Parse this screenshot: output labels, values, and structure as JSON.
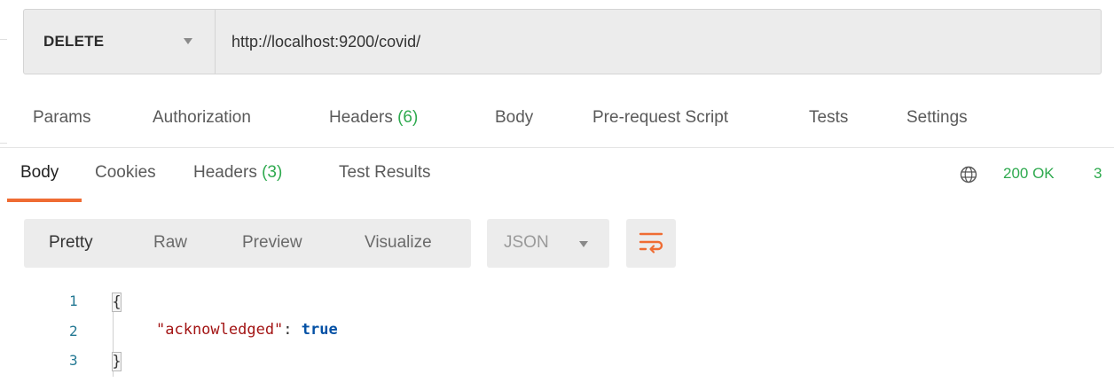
{
  "request": {
    "method": "DELETE",
    "url": "http://localhost:9200/covid/"
  },
  "request_tabs": {
    "params": "Params",
    "authorization": "Authorization",
    "headers": "Headers",
    "headers_count": "(6)",
    "body": "Body",
    "prerequest": "Pre-request Script",
    "tests": "Tests",
    "settings": "Settings"
  },
  "response_tabs": {
    "body": "Body",
    "cookies": "Cookies",
    "headers": "Headers",
    "headers_count": "(3)",
    "test_results": "Test Results"
  },
  "status": {
    "text": "200 OK",
    "time_fragment": "3"
  },
  "view_modes": {
    "pretty": "Pretty",
    "raw": "Raw",
    "preview": "Preview",
    "visualize": "Visualize"
  },
  "format": {
    "selected": "JSON"
  },
  "code": {
    "line_numbers": [
      "1",
      "2",
      "3"
    ],
    "open_brace": "{",
    "close_brace": "}",
    "key": "\"acknowledged\"",
    "colon": ": ",
    "value": "true"
  },
  "colors": {
    "accent": "#ef6c33",
    "success": "#2faa4f",
    "panel": "#ececec"
  },
  "icons": {
    "method_dropdown": "chevron-down-icon",
    "globe": "globe-icon",
    "wrap": "wrap-lines-icon",
    "format_dropdown": "chevron-down-icon"
  }
}
